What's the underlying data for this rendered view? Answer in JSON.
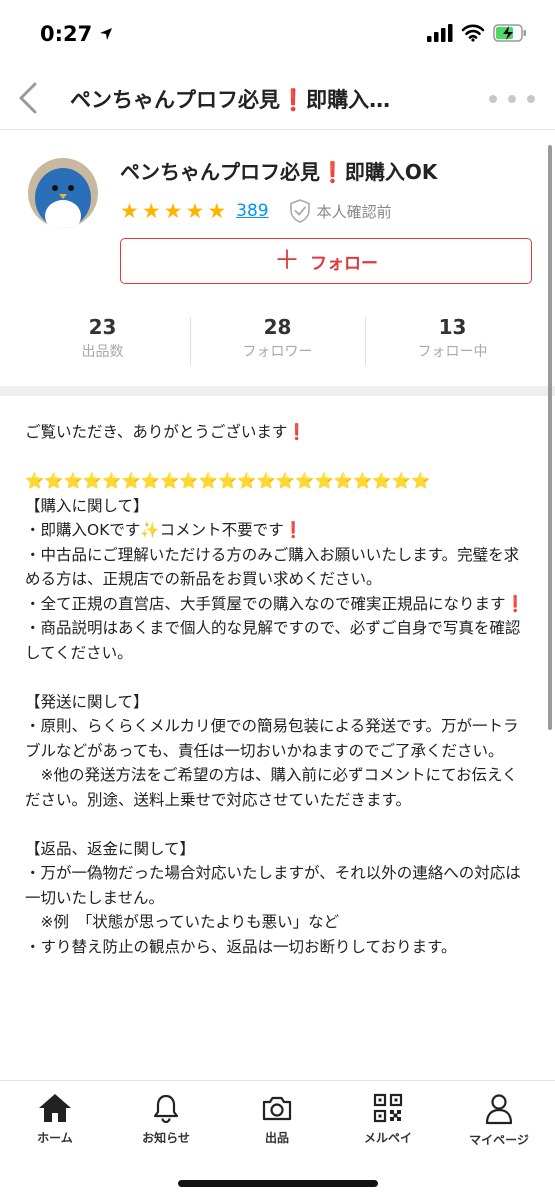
{
  "status_bar": {
    "time": "0:27"
  },
  "header": {
    "title": "ペンちゃんプロフ必見❗即購入…"
  },
  "profile": {
    "name": "ペンちゃんプロフ必見❗即購入OK",
    "rating_stars": 5,
    "rating_count": "389",
    "verification": "本人確認前",
    "follow_label": "フォロー"
  },
  "stats": [
    {
      "value": "23",
      "label": "出品数"
    },
    {
      "value": "28",
      "label": "フォロワー"
    },
    {
      "value": "13",
      "label": "フォロー中"
    }
  ],
  "description": "ご覧いただき、ありがとうございます❗\n\n⭐⭐⭐⭐⭐⭐⭐⭐⭐⭐⭐⭐⭐⭐⭐⭐⭐⭐⭐⭐⭐\n【購入に関して】\n・即購入OKです✨コメント不要です❗\n・中古品にご理解いただける方のみご購入お願いいたします。完璧を求める方は、正規店での新品をお買い求めください。\n・全て正規の直営店、大手質屋での購入なので確実正規品になります❗\n・商品説明はあくまで個人的な見解ですので、必ずご自身で写真を確認してください。\n\n【発送に関して】\n・原則、らくらくメルカリ便での簡易包装による発送です。万が一トラブルなどがあっても、責任は一切おいかねますのでご了承ください。\n　※他の発送方法をご希望の方は、購入前に必ずコメントにてお伝えください。別途、送料上乗せで対応させていただきます。\n\n【返品、返金に関して】\n・万が一偽物だった場合対応いたしますが、それ以外の連絡への対応は一切いたしません。\n　※例　「状態が思っていたよりも悪い」など\n・すり替え防止の観点から、返品は一切お断りしております。",
  "tabs": [
    {
      "label": "ホーム",
      "icon": "home-icon"
    },
    {
      "label": "お知らせ",
      "icon": "bell-icon"
    },
    {
      "label": "出品",
      "icon": "camera-icon"
    },
    {
      "label": "メルペイ",
      "icon": "qr-code-icon"
    },
    {
      "label": "マイページ",
      "icon": "person-icon"
    }
  ],
  "colors": {
    "accent": "#e0383b",
    "star": "#ffb400",
    "link": "#0095ee"
  }
}
